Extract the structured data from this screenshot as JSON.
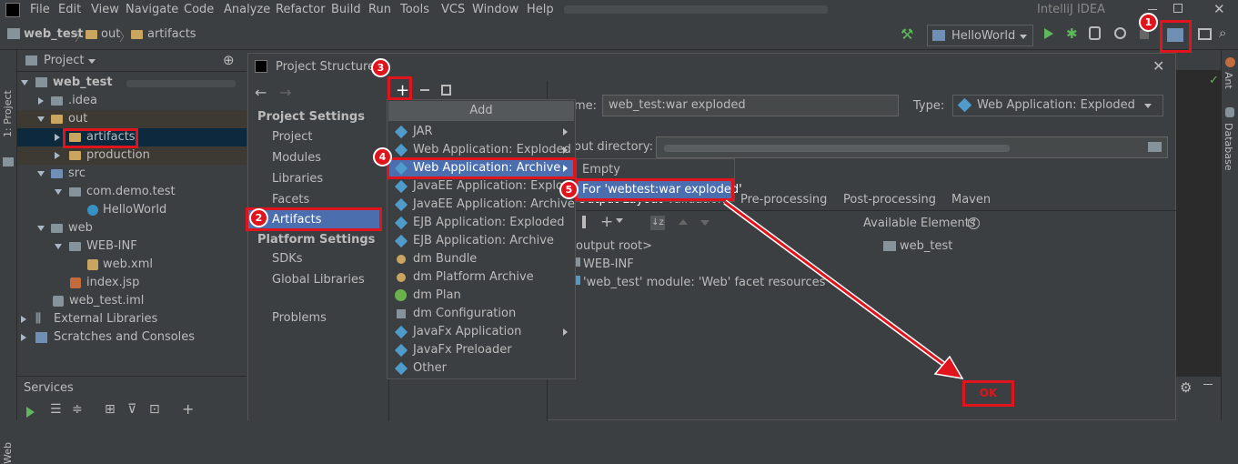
{
  "menubar": {
    "items": [
      "File",
      "Edit",
      "View",
      "Navigate",
      "Code",
      "Analyze",
      "Refactor",
      "Build",
      "Run",
      "Tools",
      "VCS",
      "Window",
      "Help"
    ],
    "app_title": "IntelliJ IDEA"
  },
  "breadcrumb": [
    "web_test",
    "out",
    "artifacts"
  ],
  "run_config": "HelloWorld",
  "left_strip_label": "1: Project",
  "bottom_strip_label": "Web",
  "right_strip": [
    "Ant",
    "Database"
  ],
  "project_panel": {
    "title": "Project",
    "tree": [
      {
        "label": "web_test",
        "bold": true,
        "level": 0
      },
      {
        "label": ".idea",
        "level": 1
      },
      {
        "label": "out",
        "level": 1
      },
      {
        "label": "artifacts",
        "level": 2
      },
      {
        "label": "production",
        "level": 2
      },
      {
        "label": "src",
        "level": 1
      },
      {
        "label": "com.demo.test",
        "level": 2
      },
      {
        "label": "HelloWorld",
        "level": 3
      },
      {
        "label": "web",
        "level": 1
      },
      {
        "label": "WEB-INF",
        "level": 2
      },
      {
        "label": "web.xml",
        "level": 3
      },
      {
        "label": "index.jsp",
        "level": 2
      },
      {
        "label": "web_test.iml",
        "level": 1
      },
      {
        "label": "External Libraries",
        "level": 0
      },
      {
        "label": "Scratches and Consoles",
        "level": 0
      }
    ]
  },
  "services": {
    "title": "Services"
  },
  "dialog": {
    "title": "Project Structure",
    "project_settings": "Project Settings",
    "project_items": [
      "Project",
      "Modules",
      "Libraries",
      "Facets",
      "Artifacts"
    ],
    "platform_settings": "Platform Settings",
    "platform_items": [
      "SDKs",
      "Global Libraries"
    ],
    "problems": "Problems",
    "name_label": "me:",
    "name_value": "web_test:war exploded",
    "type_label": "Type:",
    "type_value": "Web Application: Exploded",
    "output_label": "out directory:",
    "tabs": [
      "Output Layout",
      "Validation",
      "Pre-processing",
      "Post-processing",
      "Maven"
    ],
    "available_elements": "Available Elements",
    "available_item": "web_test",
    "layout_items": [
      "output root>",
      "WEB-INF",
      "'web_test' module: 'Web' facet resources"
    ],
    "ok_label": "OK"
  },
  "add_menu": {
    "title": "Add",
    "items": [
      {
        "label": "JAR",
        "sub": true
      },
      {
        "label": "Web Application: Exploded",
        "sub": true
      },
      {
        "label": "Web Application: Archive",
        "sub": true,
        "selected": true
      },
      {
        "label": "JavaEE Application: Exploded",
        "sub": false
      },
      {
        "label": "JavaEE Application: Archive",
        "sub": false
      },
      {
        "label": "EJB Application: Exploded",
        "sub": false
      },
      {
        "label": "EJB Application: Archive",
        "sub": false
      },
      {
        "label": "dm Bundle",
        "sub": false
      },
      {
        "label": "dm Platform Archive",
        "sub": false
      },
      {
        "label": "dm Plan",
        "sub": false
      },
      {
        "label": "dm Configuration",
        "sub": false
      },
      {
        "label": "JavaFx Application",
        "sub": true
      },
      {
        "label": "JavaFx Preloader",
        "sub": false
      },
      {
        "label": "Other",
        "sub": false
      }
    ]
  },
  "submenu": {
    "items": [
      "Empty",
      "For 'webtest:war exploded'"
    ]
  },
  "badges": [
    "1",
    "2",
    "3",
    "4",
    "5"
  ],
  "colors": {
    "accent": "#4b6eaf",
    "highlight": "#e0141c"
  }
}
